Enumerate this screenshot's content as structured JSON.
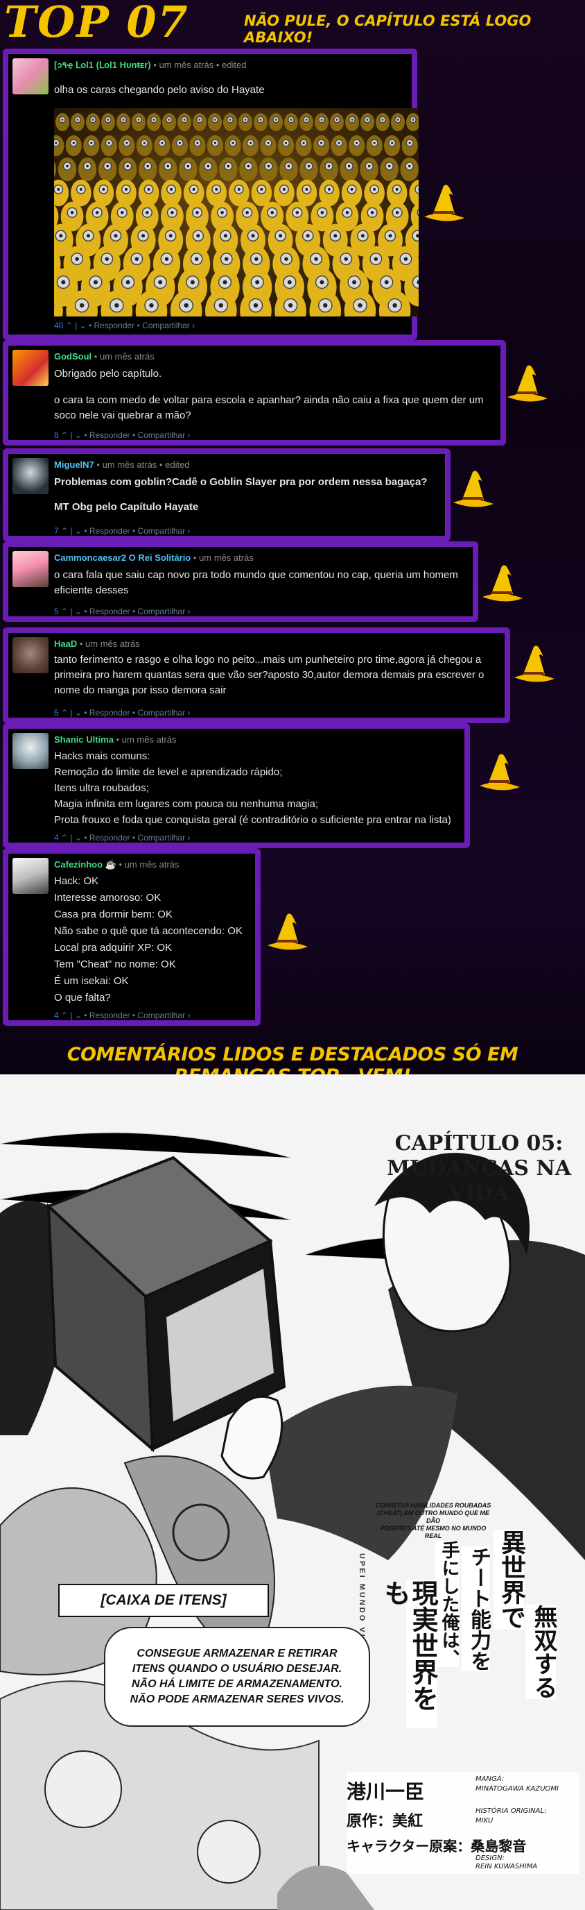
{
  "header": {
    "title": "TOP 07",
    "subtitle": "NÃO PULE, O CAPÍTULO ESTÁ LOGO ABAIXO!"
  },
  "comments": [
    {
      "username": "[ↄ۹ҿ ᒪᴏl1 (ᒪᴏl1 Hᴜnŧᴇr)",
      "meta": "• um mês atrás • edited",
      "lines": [
        "olha os caras chegando pelo aviso do Hayate"
      ],
      "votes": "40",
      "reply": "Responder",
      "share": "Compartilhar ›",
      "image_alt": "multidão de minions"
    },
    {
      "username": "GodSoul",
      "meta": "• um mês atrás",
      "lines": [
        "Obrigado pelo capítulo.",
        "",
        "o cara ta com medo de voltar para escola e apanhar? ainda não caiu a fixa que quem der um",
        "soco nele vai quebrar a mão?"
      ],
      "votes": "8",
      "reply": "Responder",
      "share": "Compartilhar ›"
    },
    {
      "username": "MiguelN7",
      "meta": "• um mês atrás • edited",
      "lines": [
        "Problemas com goblin?Cadê o Goblin Slayer pra por ordem nessa bagaça?",
        "",
        "MT Obg pelo Capítulo Hayate"
      ],
      "votes": "7",
      "reply": "Responder",
      "share": "Compartilhar ›"
    },
    {
      "username": "Cammoncaesar2 O Rei Solitário",
      "meta": "• um mês atrás",
      "lines": [
        "o cara fala que saiu cap novo pra todo mundo que comentou no cap, queria um homem",
        "eficiente desses"
      ],
      "votes": "5",
      "reply": "Responder",
      "share": "Compartilhar ›"
    },
    {
      "username": "HaaD",
      "meta": "• um mês atrás",
      "lines": [
        "tanto ferimento e rasgo e olha logo no peito...mais um punheteiro pro time,agora já chegou a",
        "primeira pro harem quantas sera que vão ser?aposto 30,autor demora demais pra escrever o",
        "nome do manga por isso demora sair"
      ],
      "votes": "5",
      "reply": "Responder",
      "share": "Compartilhar ›"
    },
    {
      "username": "Shanic Ultima",
      "meta": "• um mês atrás",
      "lines": [
        "Hacks mais comuns:",
        "Remoção do limite de level e aprendizado rápido;",
        "Itens ultra roubados;",
        "Magia infinita em lugares com pouca ou nenhuma magia;",
        "Prota frouxo e foda que conquista geral (é contraditório o suficiente pra entrar na lista)"
      ],
      "votes": "4",
      "reply": "Responder",
      "share": "Compartilhar ›"
    },
    {
      "username": "Cafezinhoo ☕",
      "meta": "• um mês atrás",
      "lines": [
        "Hack: OK",
        "Interesse amoroso: OK",
        "Casa pra dormir bem: OK",
        "Não sabe o quê que tá acontecendo: OK",
        "Local pra adquirir XP: OK",
        "Tem \"Cheat\" no nome: OK",
        "É um isekai: OK",
        "O que falta?"
      ],
      "votes": "4",
      "reply": "Responder",
      "share": "Compartilhar ›"
    }
  ],
  "footer": {
    "text": "COMENTÁRIOS LIDOS E DESTACADOS SÓ EM REMANGAS.TOP , VEM!"
  },
  "manga": {
    "chapter_line1": "CAPÍTULO 05:",
    "chapter_line2": "MUDANÇAS NA",
    "chapter_line3": "VIDA",
    "box_title": "[CAIXA DE ITENS]",
    "box_lines": [
      "CONSEGUE ARMAZENAR E RETIRAR",
      "ITENS QUANDO O USUÁRIO DESEJAR.",
      "NÃO HÁ LIMITE DE ARMAZENAMENTO.",
      "NÃO PODE ARMAZENAR SERES VIVOS."
    ],
    "tagline_lines": [
      "CONSEGUI HABILIDADES ROUBADAS",
      "(CHEAT) EM OUTRO MUNDO QUE ME DÃO",
      "PODERES ATÉ MESMO NO MUNDO REAL"
    ],
    "jp_title_1": "異世界で",
    "jp_title_2": "チート能力を",
    "jp_title_3": "手にした俺は、",
    "jp_title_4": "現実世界をも",
    "jp_title_5": "無双する",
    "vertical_tag": "UPEI MUNDO VIDA",
    "credit_manga_label": "MANGÁ:",
    "credit_manga_name": "MINATOGAWA KAZUOMI",
    "credit_manga_jp": "港川一臣",
    "credit_story_label": "HISTÓRIA ORIGINAL:",
    "credit_story_name": "MIKU",
    "credit_story_jp": "原作：美紅",
    "credit_design_label": "DESIGN:",
    "credit_design_name": "REIN KUWASHIMA",
    "credit_design_jp": "キャラクター原案：桑島黎音"
  },
  "colors": {
    "accent_yellow": "#f5c400",
    "border_purple": "#6a1db5",
    "username_blue": "#4fc3f7",
    "username_green": "#3ddc84",
    "card_bg": "#000000"
  }
}
